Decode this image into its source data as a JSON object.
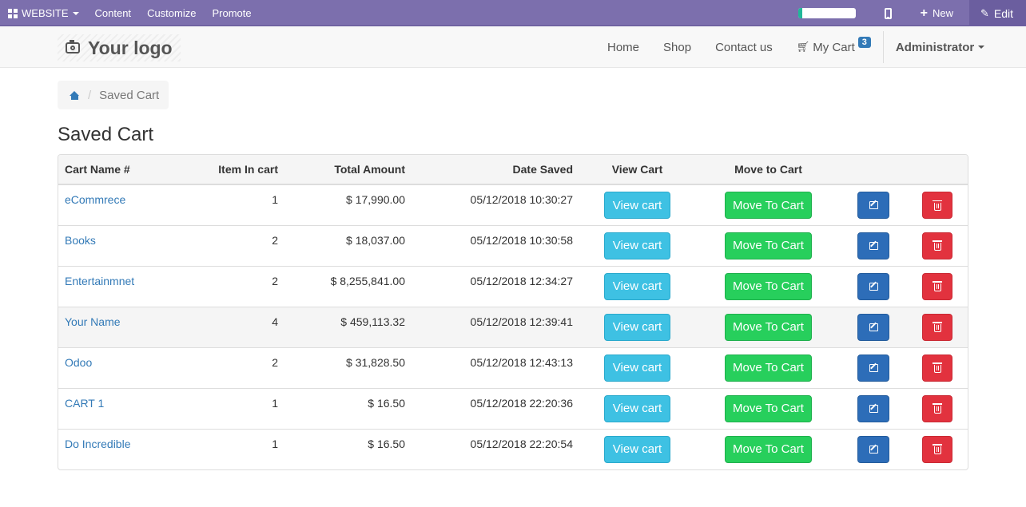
{
  "adminbar": {
    "website_label": "WEBSITE",
    "content_label": "Content",
    "customize_label": "Customize",
    "promote_label": "Promote",
    "progress_percent": 8,
    "new_label": "New",
    "edit_label": "Edit"
  },
  "header": {
    "logo_text": "Your logo",
    "nav": {
      "home": "Home",
      "shop": "Shop",
      "contact": "Contact us",
      "cart": "My Cart",
      "cart_count": "3",
      "user": "Administrator"
    }
  },
  "breadcrumb": {
    "current": "Saved Cart"
  },
  "page_title": "Saved Cart",
  "table": {
    "headers": {
      "name": "Cart Name #",
      "items": "Item In cart",
      "total": "Total Amount",
      "date": "Date Saved",
      "view": "View Cart",
      "move": "Move to Cart"
    },
    "buttons": {
      "view": "View cart",
      "move": "Move To Cart"
    },
    "rows": [
      {
        "name": "eCommrece",
        "items": "1",
        "total": "$ 17,990.00",
        "date": "05/12/2018 10:30:27"
      },
      {
        "name": "Books",
        "items": "2",
        "total": "$ 18,037.00",
        "date": "05/12/2018 10:30:58"
      },
      {
        "name": "Entertainmnet",
        "items": "2",
        "total": "$ 8,255,841.00",
        "date": "05/12/2018 12:34:27"
      },
      {
        "name": "Your Name",
        "items": "4",
        "total": "$ 459,113.32",
        "date": "05/12/2018 12:39:41"
      },
      {
        "name": "Odoo",
        "items": "2",
        "total": "$ 31,828.50",
        "date": "05/12/2018 12:43:13"
      },
      {
        "name": "CART 1",
        "items": "1",
        "total": "$ 16.50",
        "date": "05/12/2018 22:20:36"
      },
      {
        "name": "Do Incredible",
        "items": "1",
        "total": "$ 16.50",
        "date": "05/12/2018 22:20:54"
      }
    ]
  },
  "colors": {
    "adminbar": "#7c6fad",
    "link": "#337ab7",
    "view_button": "#3ec1e3",
    "move_button": "#27cf5c",
    "edit_button": "#2d6db8",
    "delete_button": "#e2323e"
  }
}
